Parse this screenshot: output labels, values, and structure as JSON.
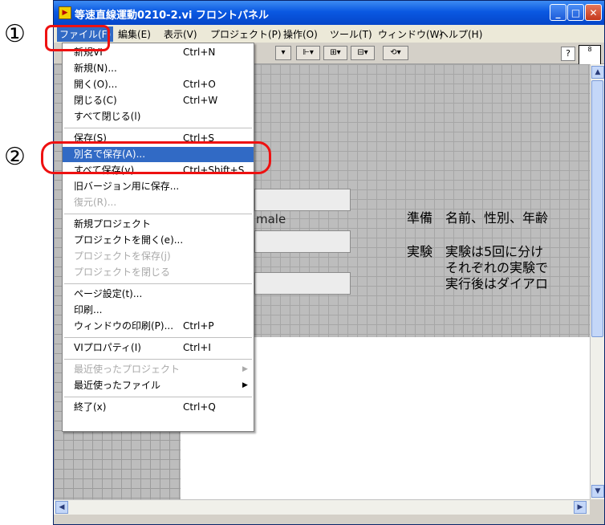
{
  "annotations": {
    "step1": "①",
    "step2": "②"
  },
  "window": {
    "title": "等速直線運動0210-2.vi フロントパネル",
    "icon_text": "▶",
    "buttons": {
      "minimize": "_",
      "maximize": "□",
      "close": "✕"
    }
  },
  "menubar": [
    {
      "label": "ファイル(F)",
      "active": true
    },
    {
      "label": "編集(E)"
    },
    {
      "label": "表示(V)"
    },
    {
      "label": "プロジェクト(P)"
    },
    {
      "label": "操作(O)"
    },
    {
      "label": "ツール(T)"
    },
    {
      "label": "ウィンドウ(W)"
    },
    {
      "label": "ヘルプ(H)"
    }
  ],
  "toolbar": {
    "help": "?",
    "vi_icon": "8"
  },
  "file_menu": {
    "items": [
      {
        "label": "新規VI",
        "shortcut": "Ctrl+N"
      },
      {
        "label": "新規(N)..."
      },
      {
        "label": "開く(O)...",
        "shortcut": "Ctrl+O"
      },
      {
        "label": "閉じる(C)",
        "shortcut": "Ctrl+W"
      },
      {
        "label": "すべて閉じる(l)"
      },
      {
        "sep": true
      },
      {
        "label": "保存(S)",
        "shortcut": "Ctrl+S"
      },
      {
        "label": "別名で保存(A)...",
        "highlight": true
      },
      {
        "label": "すべて保存(v)",
        "shortcut": "Ctrl+Shift+S"
      },
      {
        "label": "旧バージョン用に保存..."
      },
      {
        "label": "復元(R)...",
        "disabled": true
      },
      {
        "sep": true
      },
      {
        "label": "新規プロジェクト"
      },
      {
        "label": "プロジェクトを開く(e)..."
      },
      {
        "label": "プロジェクトを保存(j)",
        "disabled": true
      },
      {
        "label": "プロジェクトを閉じる",
        "disabled": true
      },
      {
        "sep": true
      },
      {
        "label": "ページ設定(t)..."
      },
      {
        "label": "印刷..."
      },
      {
        "label": "ウィンドウの印刷(P)...",
        "shortcut": "Ctrl+P"
      },
      {
        "sep": true
      },
      {
        "label": "VIプロパティ(I)",
        "shortcut": "Ctrl+I"
      },
      {
        "sep": true
      },
      {
        "label": "最近使ったプロジェクト",
        "submenu": true,
        "disabled": true
      },
      {
        "label": "最近使ったファイル",
        "submenu": true
      },
      {
        "sep": true
      },
      {
        "label": "終了(x)",
        "shortcut": "Ctrl+Q"
      }
    ]
  },
  "panel": {
    "male_label": "male",
    "lines": [
      "準備　名前、性別、年齢",
      "実験　実験は5回に分け",
      "　　　それぞれの実験で",
      "　　　実行後はダイアロ"
    ]
  },
  "colors": {
    "highlight": "#316ac5",
    "annotation_red": "#ee1111",
    "title_blue": "#0a58e2"
  }
}
